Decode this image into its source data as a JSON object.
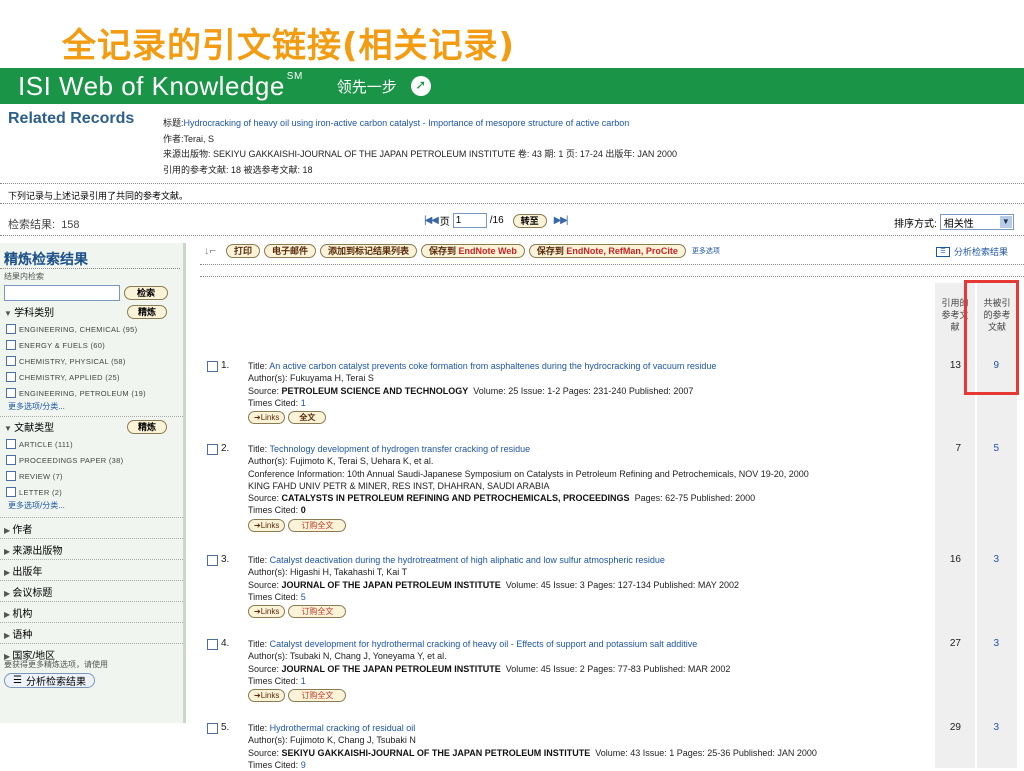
{
  "slide_title": "全记录的引文链接(相关记录)",
  "banner": {
    "brand": "ISI Web of Knowledge",
    "brand_mark": "SM",
    "slogan": "领先一步",
    "go_icon": "arrow-go-icon"
  },
  "header": {
    "section_title": "Related Records",
    "title_label": "标题:",
    "title_value": "Hydrocracking of heavy oil using iron-active carbon catalyst - Importance of mesopore structure of active carbon",
    "author_label": "作者:",
    "author_value": "Terai, S",
    "source_line": "来源出版物: SEKIYU GAKKAISHI-JOURNAL OF THE JAPAN PETROLEUM INSTITUTE 卷: 43 期: 1 页: 17-24 出版年: JAN 2000",
    "refs_line": "引用的参考文献: 18 被选参考文献: 18"
  },
  "common_note": "下列记录与上述记录引用了共同的参考文献。",
  "results": {
    "label": "检索结果:",
    "count": "158"
  },
  "pager": {
    "first_prev": "|◀ ◀",
    "page_label": "页",
    "page_value": "1",
    "total": "/16",
    "go_label": "转至",
    "next_last": "▶ ▶|"
  },
  "sort": {
    "label": "排序方式:",
    "value": "相关性"
  },
  "sidebar": {
    "title": "精炼检索结果",
    "search_within": "结果内检索",
    "search_button": "检索",
    "subject": {
      "label": "学科类别",
      "button": "精炼",
      "items": [
        "ENGINEERING, CHEMICAL (95)",
        "ENERGY & FUELS (60)",
        "CHEMISTRY, PHYSICAL (58)",
        "CHEMISTRY, APPLIED (25)",
        "ENGINEERING, PETROLEUM (19)"
      ]
    },
    "more1": "更多选项/分类...",
    "doctype": {
      "label": "文献类型",
      "button": "精炼",
      "items": [
        "ARTICLE (111)",
        "PROCEEDINGS PAPER (38)",
        "REVIEW (7)",
        "LETTER (2)"
      ]
    },
    "more2": "更多选项/分类...",
    "collapsed": [
      "作者",
      "来源出版物",
      "出版年",
      "会议标题",
      "机构",
      "语种",
      "国家/地区"
    ],
    "note": "要获得更多精炼选项，请使用",
    "analyze": "分析检索结果"
  },
  "toolbar": {
    "print": "打印",
    "email": "电子邮件",
    "add_marked": "添加到标记结果列表",
    "save_en_pre": "保存到",
    "save_en_web": "EndNote Web",
    "save_local_pre": "保存到",
    "save_local": "EndNote, RefMan, ProCite",
    "more": "更多选项",
    "analyze": "分析检索结果"
  },
  "columns": {
    "cited_refs": "引用的参考文献",
    "shared_refs": "共被引的参考文献"
  },
  "records": [
    {
      "num": "1.",
      "title": "An active carbon catalyst prevents coke formation from asphaltenes during the hydrocracking of vacuum residue",
      "authors": "Author(s): Fukuyama H, Terai S",
      "conf": "",
      "org": "",
      "source_pre": "Source: ",
      "source": "PETROLEUM SCIENCE AND TECHNOLOGY",
      "details": "Volume: 25  Issue: 1-2  Pages: 231-240  Published: 2007",
      "cited_label": "Times Cited: ",
      "cited": "1",
      "links": "➔Links",
      "fulltext": "全文",
      "refs": "13",
      "shared": "9"
    },
    {
      "num": "2.",
      "title": "Technology development of hydrogen transfer cracking of residue",
      "authors": "Author(s): Fujimoto K, Terai S, Uehara K, et al.",
      "conf": "Conference Information: 10th Annual Saudi-Japanese Symposium on Catalysts in Petroleum Refining and Petrochemicals, NOV 19-20, 2000",
      "org": "KING FAHD UNIV PETR & MINER, RES INST, DHAHRAN, SAUDI ARABIA",
      "source_pre": "Source: ",
      "source": "CATALYSTS IN PETROLEUM REFINING AND PETROCHEMICALS, PROCEEDINGS",
      "details": "Pages: 62-75  Published: 2000",
      "cited_label": "Times Cited: ",
      "cited": "0",
      "links": "➔Links",
      "fulltext": "订购全文",
      "refs": "7",
      "shared": "5"
    },
    {
      "num": "3.",
      "title": "Catalyst deactivation during the hydrotreatment of high aliphatic and low sulfur atmospheric residue",
      "authors": "Author(s): Higashi H, Takahashi T, Kai T",
      "conf": "",
      "org": "",
      "source_pre": "Source: ",
      "source": "JOURNAL OF THE JAPAN PETROLEUM INSTITUTE",
      "details": "Volume: 45  Issue: 3  Pages: 127-134  Published: MAY 2002",
      "cited_label": "Times Cited: ",
      "cited": "5",
      "links": "➔Links",
      "fulltext": "订购全文",
      "refs": "16",
      "shared": "3"
    },
    {
      "num": "4.",
      "title": "Catalyst development for hydrothermal cracking of heavy oil - Effects of support and potassium salt additive",
      "authors": "Author(s): Tsubaki N, Chang J, Yoneyama Y, et al.",
      "conf": "",
      "org": "",
      "source_pre": "Source: ",
      "source": "JOURNAL OF THE JAPAN PETROLEUM INSTITUTE",
      "details": "Volume: 45  Issue: 2  Pages: 77-83  Published: MAR 2002",
      "cited_label": "Times Cited: ",
      "cited": "1",
      "links": "➔Links",
      "fulltext": "订购全文",
      "refs": "27",
      "shared": "3"
    },
    {
      "num": "5.",
      "title": "Hydrothermal cracking of residual oil",
      "authors": "Author(s): Fujimoto K, Chang J, Tsubaki N",
      "conf": "",
      "org": "",
      "source_pre": "Source: ",
      "source": "SEKIYU GAKKAISHI-JOURNAL OF THE JAPAN PETROLEUM INSTITUTE",
      "details": "Volume: 43  Issue: 1  Pages: 25-36  Published: JAN 2000",
      "cited_label": "Times Cited: ",
      "cited": "9",
      "links": "",
      "fulltext": "",
      "refs": "29",
      "shared": "3"
    }
  ],
  "colors": {
    "brand_green": "#1a9446",
    "title_orange": "#f39c12",
    "link_blue": "#1d56a5",
    "highlight_red": "#e53935"
  }
}
